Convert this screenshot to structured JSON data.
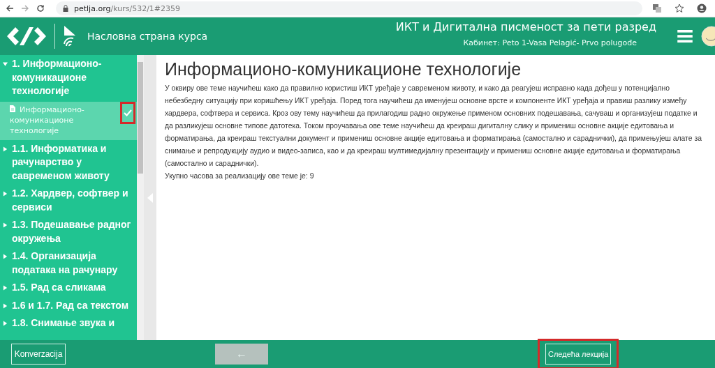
{
  "browser": {
    "url_host": "petlja.org",
    "url_path": "/kurs/532/1#2359"
  },
  "header": {
    "home_link": "Насловна страна курса",
    "title": "ИКТ и Дигитална писменост за пети разред",
    "subtitle": "Кабинет: Peto 1-Vasa Pelagić- Prvo polugođe"
  },
  "sidebar": {
    "items": [
      {
        "label": "1. Информационо-комуникационе технологије",
        "expanded": true,
        "children": [
          {
            "label": "Информационо-комуникационе технологије",
            "selected": true,
            "done": true,
            "highlighted": true
          }
        ]
      },
      {
        "label": "1.1. Информатика и рачунарство у савременом животу",
        "expanded": false
      },
      {
        "label": "1.2. Хардвер, софтвер и сервиси",
        "expanded": false
      },
      {
        "label": "1.3. Подешавање радног окружења",
        "expanded": false
      },
      {
        "label": "1.4. Организација података на рачунару",
        "expanded": false
      },
      {
        "label": "1.5. Рад са сликама",
        "expanded": false
      },
      {
        "label": "1.6 и 1.7. Рад са текстом",
        "expanded": false
      },
      {
        "label": "1.8. Снимање звука и",
        "expanded": false
      }
    ]
  },
  "content": {
    "heading": "Информационо-комуникационе технологије",
    "paragraph": "У оквиру ове теме научићеш како да правилно користиш ИКТ уређаје у савременом животу, и како да реагујеш исправно када дођеш у потенцијално небезбедну ситуацију при коришћењу ИКТ уређаја. Поред тога научићеш да именујеш основне врсте и компоненте ИКТ уређаја и правиш разлику између хардвера, софтвера и сервиса. Кроз ову тему научићеш да прилагодиш радно окружење применом основних подешавања, сачуваш и организујеш податке и да разликујеш основне типове датотека. Током проучавања ове теме научићеш да креираш дигиталну слику и примениш основне акције едитовања и форматирања, да креираш текстуални документ и примениш основне акције едитовања и форматирања (самостално и сараднички), да примењујеш алате за снимање и репродукцију аудио и видео-записа, као и да креираш мултимедијалну презентацију и примениш основне акције едитовања и форматирања (самостално и сараднички).",
    "hours": "Укупно часова за реализацију ове теме је: 9"
  },
  "footer": {
    "chat_button": "Konverzacija",
    "back_button": {
      "label": "←",
      "disabled": true
    },
    "next_button": {
      "label": "Следећа лекција",
      "highlighted": true
    }
  }
}
